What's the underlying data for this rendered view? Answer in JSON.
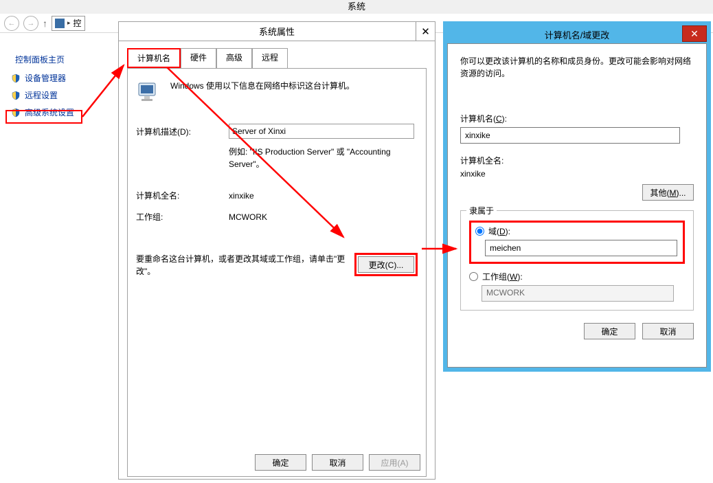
{
  "sysbar": {
    "title": "系统"
  },
  "nav": {
    "addr": "控"
  },
  "cpane": {
    "heading": "控制面板主页",
    "items": [
      "设备管理器",
      "远程设置",
      "高级系统设置"
    ]
  },
  "dlg1": {
    "title": "系统属性",
    "tabs": [
      "计算机名",
      "硬件",
      "高级",
      "远程"
    ],
    "intro": "Windows 使用以下信息在网络中标识这台计算机。",
    "desc_label": "计算机描述(D):",
    "desc_value": "Server of Xinxi",
    "example": "例如: \"IIS Production Server\" 或 \"Accounting Server\"。",
    "fullname_lbl": "计算机全名:",
    "fullname_val": "xinxike",
    "workgroup_lbl": "工作组:",
    "workgroup_val": "MCWORK",
    "rename_text": "要重命名这台计算机，或者更改其域或工作组，请单击\"更改\"。",
    "change_btn": "更改(C)...",
    "ok": "确定",
    "cancel": "取消",
    "apply": "应用(A)"
  },
  "dlg2": {
    "title": "计算机名/域更改",
    "intro": "你可以更改该计算机的名称和成员身份。更改可能会影响对网络资源的访问。",
    "compname_lbl": "计算机名(C):",
    "compname_lbl_u": "C",
    "compname_val": "xinxike",
    "fullname_lbl": "计算机全名:",
    "fullname_val": "xinxike",
    "other_btn": "其他(M)...",
    "group_legend": "隶属于",
    "domain_lbl": "域(D):",
    "domain_lbl_u": "D",
    "domain_val": "meichen",
    "workgroup_lbl": "工作组(W):",
    "workgroup_lbl_u": "W",
    "workgroup_val": "MCWORK",
    "ok": "确定",
    "cancel": "取消"
  }
}
